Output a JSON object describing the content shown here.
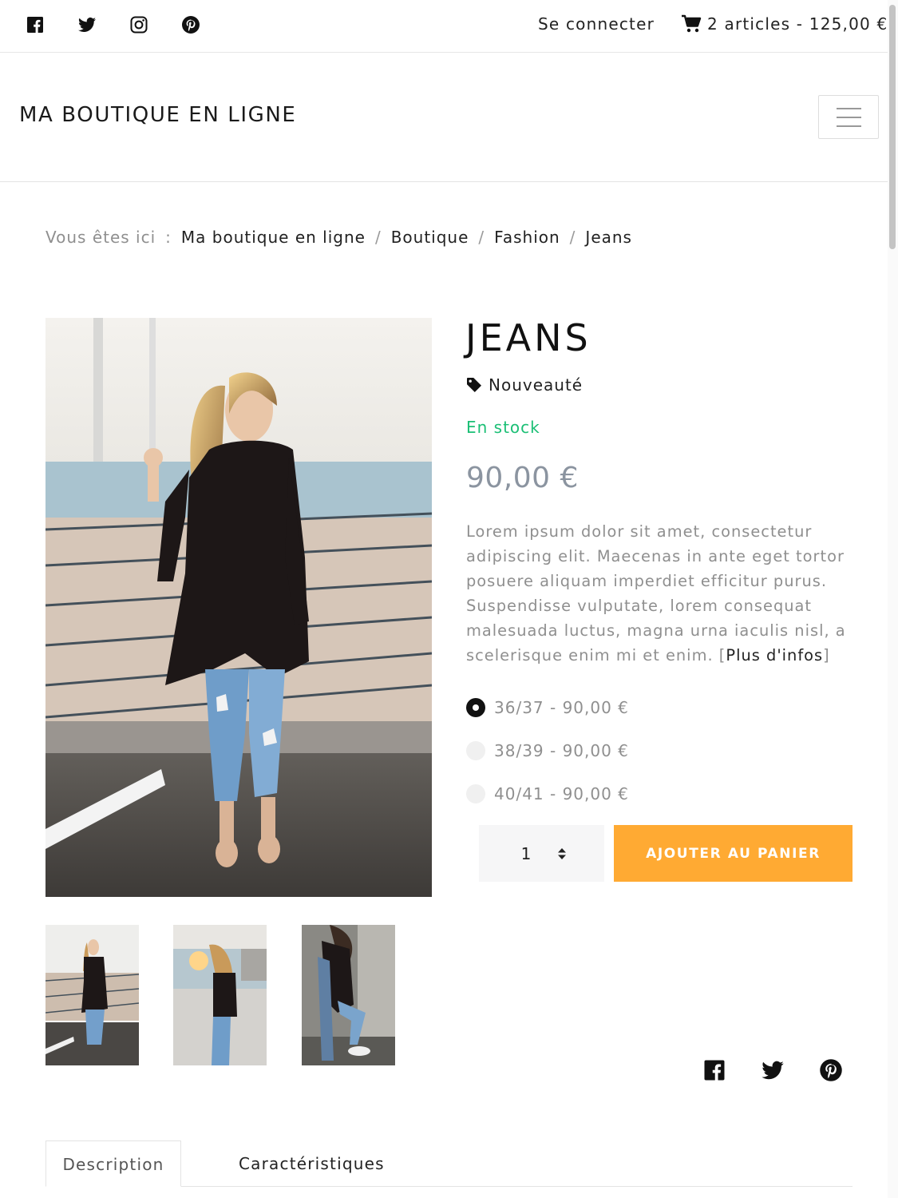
{
  "topbar": {
    "social": [
      {
        "icon": "facebook-icon"
      },
      {
        "icon": "twitter-icon"
      },
      {
        "icon": "instagram-icon"
      },
      {
        "icon": "pinterest-icon"
      }
    ],
    "login_label": "Se connecter",
    "cart_icon": "cart-icon",
    "cart_summary": "2 articles - 125,00 €"
  },
  "header": {
    "brand": "MA BOUTIQUE EN LIGNE",
    "menu_icon": "hamburger-menu-icon"
  },
  "breadcrumb": {
    "prefix": "Vous êtes ici",
    "colon": ":",
    "separator": "/",
    "items": [
      "Ma boutique en ligne",
      "Boutique",
      "Fashion",
      "Jeans"
    ]
  },
  "product": {
    "title": "JEANS",
    "tag_icon": "tag-icon",
    "tag": "Nouveauté",
    "stock": "En stock",
    "price": "90,00 €",
    "description": "Lorem ipsum dolor sit amet, consectetur adipiscing elit. Maecenas in ante eget tortor posuere aliquam imperdiet efficitur purus. Suspendisse vulputate, lorem consequat malesuada luctus, magna urna iaculis nisl, a scelerisque enim mi et enim.",
    "more_open": "[",
    "more_label": "Plus d'infos",
    "more_close": "]",
    "variants": [
      {
        "label": "36/37 - 90,00 €",
        "selected": true
      },
      {
        "label": "38/39 - 90,00 €",
        "selected": false
      },
      {
        "label": "40/41 - 90,00 €",
        "selected": false
      }
    ],
    "quantity": "1",
    "add_to_cart": "AJOUTER AU PANIER",
    "share": [
      {
        "icon": "facebook-icon"
      },
      {
        "icon": "twitter-icon"
      },
      {
        "icon": "pinterest-icon"
      }
    ]
  },
  "tabs": [
    {
      "label": "Description",
      "active": true
    },
    {
      "label": "Caractéristiques",
      "active": false
    }
  ],
  "colors": {
    "accent": "#ffaa33",
    "stock": "#1bbf75",
    "price": "#8b94a0"
  }
}
